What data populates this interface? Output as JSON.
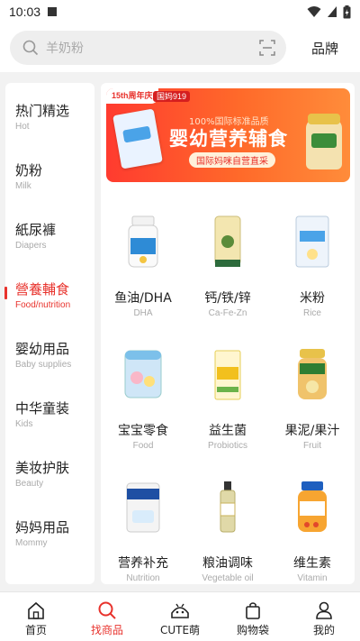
{
  "status": {
    "time": "10:03"
  },
  "search": {
    "placeholder": "羊奶粉",
    "brand_label": "品牌"
  },
  "categories": [
    {
      "zh": "热门精选",
      "en": "Hot"
    },
    {
      "zh": "奶粉",
      "en": "Milk"
    },
    {
      "zh": "紙尿褲",
      "en": "Diapers"
    },
    {
      "zh": "營養輔食",
      "en": "Food/nutrition"
    },
    {
      "zh": "婴幼用品",
      "en": "Baby supplies"
    },
    {
      "zh": "中华童装",
      "en": "Kids"
    },
    {
      "zh": "美妆护肤",
      "en": "Beauty"
    },
    {
      "zh": "妈妈用品",
      "en": "Mommy"
    }
  ],
  "active_category_index": 3,
  "banner": {
    "badge": "15th周年庆",
    "badge2": "国妈919",
    "subtitle": "100%国际标准品质",
    "title": "婴幼营养辅食",
    "pill": "国际妈咪自营直采"
  },
  "products": [
    {
      "zh": "鱼油/DHA",
      "en": "DHA",
      "icon": "fish-oil-bottle-icon"
    },
    {
      "zh": "钙/铁/锌",
      "en": "Ca-Fe-Zn",
      "icon": "calcium-tube-icon"
    },
    {
      "zh": "米粉",
      "en": "Rice",
      "icon": "rice-cereal-box-icon"
    },
    {
      "zh": "宝宝零食",
      "en": "Food",
      "icon": "baby-snack-can-icon"
    },
    {
      "zh": "益生菌",
      "en": "Probiotics",
      "icon": "probiotics-box-icon"
    },
    {
      "zh": "果泥/果汁",
      "en": "Fruit",
      "icon": "fruit-puree-jar-icon"
    },
    {
      "zh": "营养补充",
      "en": "Nutrition",
      "icon": "nutrition-can-icon"
    },
    {
      "zh": "粮油调味",
      "en": "Vegetable oil",
      "icon": "oil-bottle-icon"
    },
    {
      "zh": "维生素",
      "en": "Vitamin",
      "icon": "vitamin-jar-icon"
    }
  ],
  "nav": [
    {
      "label": "首页",
      "icon": "home-icon"
    },
    {
      "label": "找商品",
      "icon": "search-icon"
    },
    {
      "label": "CUTE萌",
      "icon": "cute-icon"
    },
    {
      "label": "购物袋",
      "icon": "shopping-bag-icon"
    },
    {
      "label": "我的",
      "icon": "profile-icon"
    }
  ],
  "nav_active_index": 1,
  "colors": {
    "accent": "#e8322c",
    "background": "#f2f2f2"
  }
}
